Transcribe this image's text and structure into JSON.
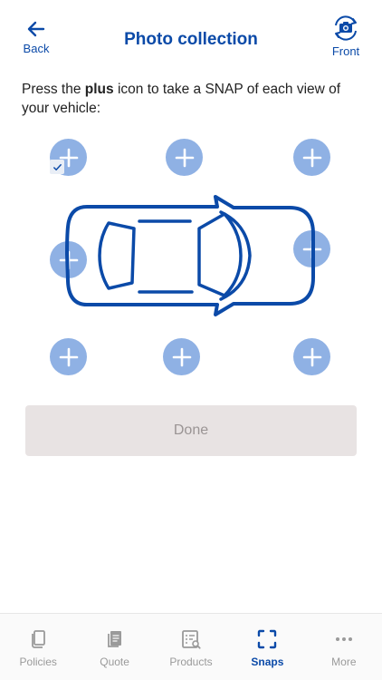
{
  "header": {
    "back_label": "Back",
    "title": "Photo collection",
    "front_label": "Front"
  },
  "instructions": {
    "prefix": "Press the ",
    "bold": "plus",
    "suffix": " icon to take a SNAP of each view of your vehicle:"
  },
  "done_label": "Done",
  "colors": {
    "accent": "#0b4aa8",
    "plus_button": "#8fb1e4",
    "done_disabled_bg": "#e8e3e3",
    "done_disabled_text": "#9a9494"
  },
  "tabs": [
    {
      "label": "Policies",
      "icon": "policies-icon"
    },
    {
      "label": "Quote",
      "icon": "quote-icon"
    },
    {
      "label": "Products",
      "icon": "products-icon"
    },
    {
      "label": "Snaps",
      "icon": "snaps-icon",
      "active": true
    },
    {
      "label": "More",
      "icon": "more-icon"
    }
  ]
}
